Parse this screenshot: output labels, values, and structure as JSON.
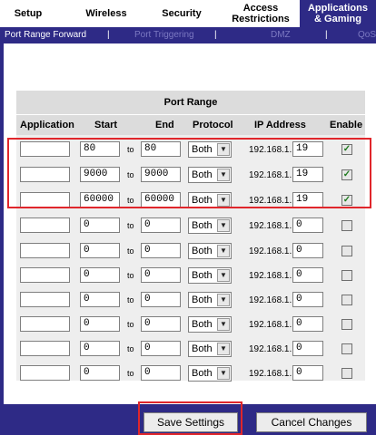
{
  "nav": {
    "tabs": [
      {
        "label": "Setup"
      },
      {
        "label": "Wireless"
      },
      {
        "label": "Security"
      },
      {
        "label": "Access\nRestrictions"
      },
      {
        "label": "Applications\n& Gaming",
        "active": true
      }
    ]
  },
  "subnav": {
    "items": [
      {
        "label": "Port Range Forward",
        "active": true
      },
      {
        "label": "Port Triggering"
      },
      {
        "label": "DMZ"
      },
      {
        "label": "QoS"
      }
    ],
    "separator": "|"
  },
  "table": {
    "group_header": "Port Range",
    "columns": [
      "Application",
      "Start",
      "End",
      "Protocol",
      "IP Address",
      "Enable"
    ],
    "to_label": "to",
    "ip_prefix": "192.168.1.",
    "rows": [
      {
        "application": "",
        "start": "80",
        "end": "80",
        "protocol": "Both",
        "ip_last": "19",
        "enabled": true
      },
      {
        "application": "",
        "start": "9000",
        "end": "9000",
        "protocol": "Both",
        "ip_last": "19",
        "enabled": true
      },
      {
        "application": "",
        "start": "60000",
        "end": "60000",
        "protocol": "Both",
        "ip_last": "19",
        "enabled": true
      },
      {
        "application": "",
        "start": "0",
        "end": "0",
        "protocol": "Both",
        "ip_last": "0",
        "enabled": false
      },
      {
        "application": "",
        "start": "0",
        "end": "0",
        "protocol": "Both",
        "ip_last": "0",
        "enabled": false
      },
      {
        "application": "",
        "start": "0",
        "end": "0",
        "protocol": "Both",
        "ip_last": "0",
        "enabled": false
      },
      {
        "application": "",
        "start": "0",
        "end": "0",
        "protocol": "Both",
        "ip_last": "0",
        "enabled": false
      },
      {
        "application": "",
        "start": "0",
        "end": "0",
        "protocol": "Both",
        "ip_last": "0",
        "enabled": false
      },
      {
        "application": "",
        "start": "0",
        "end": "0",
        "protocol": "Both",
        "ip_last": "0",
        "enabled": false
      },
      {
        "application": "",
        "start": "0",
        "end": "0",
        "protocol": "Both",
        "ip_last": "0",
        "enabled": false
      }
    ]
  },
  "buttons": {
    "save": "Save Settings",
    "cancel": "Cancel Changes"
  },
  "colors": {
    "nav_blue": "#2e2a86",
    "highlight_red": "#e0262b"
  }
}
